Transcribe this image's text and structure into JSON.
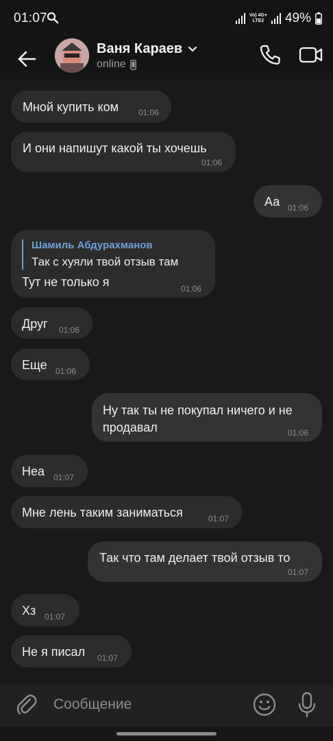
{
  "status_bar": {
    "time": "01:07",
    "net_top": "Vo) 4G+",
    "net_bottom": "LTE2",
    "battery": "49%"
  },
  "header": {
    "contact_name": "Ваня Караев",
    "status": "online"
  },
  "messages": [
    {
      "dir": "in",
      "text": "Мной купить ком",
      "time": "01:06"
    },
    {
      "dir": "in",
      "text": "И они напишут какой ты хочешь",
      "time": "01:06"
    },
    {
      "dir": "out",
      "text": "Аа",
      "time": "01:06"
    },
    {
      "dir": "in",
      "reply_author": "Шамиль Абдурахманов",
      "reply_text": "Так с хуяли твой отзыв там",
      "text": "Тут не только я",
      "time": "01:06"
    },
    {
      "dir": "in",
      "text": "Друг",
      "time": "01:06"
    },
    {
      "dir": "in",
      "text": "Еще",
      "time": "01:06"
    },
    {
      "dir": "out",
      "text_line1": "Ну так ты не покупал ничего и не",
      "text_line2": "продавал",
      "time": "01:06"
    },
    {
      "dir": "in",
      "text": "Неа",
      "time": "01:07"
    },
    {
      "dir": "in",
      "text": "Мне лень таким заниматься",
      "time": "01:07"
    },
    {
      "dir": "out",
      "text": "Так что там делает твой отзыв то",
      "time": "01:07"
    },
    {
      "dir": "in",
      "text": "Хз",
      "time": "01:07"
    },
    {
      "dir": "in",
      "text": "Не я писал",
      "time": "01:07"
    }
  ],
  "composer": {
    "placeholder": "Сообщение"
  }
}
